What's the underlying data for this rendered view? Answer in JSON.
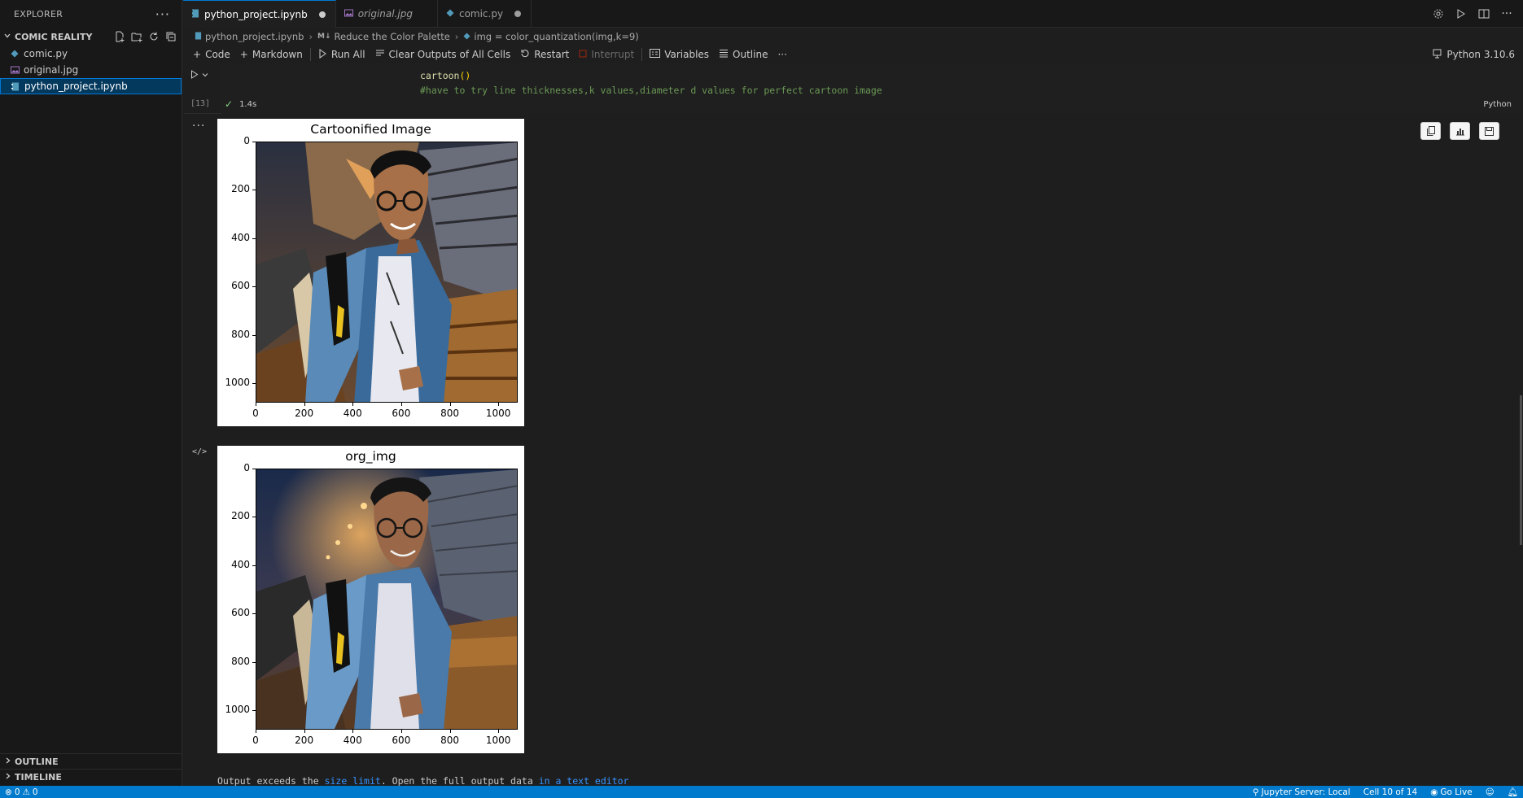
{
  "sidebar": {
    "title": "EXPLORER",
    "more": "···",
    "folder": "COMIC REALITY",
    "files": [
      {
        "name": "comic.py",
        "icon": "python-file-icon",
        "color": "#519aba"
      },
      {
        "name": "original.jpg",
        "icon": "image-file-icon",
        "color": "#a074c4"
      },
      {
        "name": "python_project.ipynb",
        "icon": "notebook-file-icon",
        "color": "#519aba"
      }
    ],
    "outline": "OUTLINE",
    "timeline": "TIMELINE"
  },
  "tabs": [
    {
      "label": "python_project.ipynb",
      "active": true,
      "dirty": true
    },
    {
      "label": "original.jpg",
      "active": false,
      "italic": true
    },
    {
      "label": "comic.py",
      "active": false,
      "dirty": true
    }
  ],
  "breadcrumb": {
    "file": "python_project.ipynb",
    "md_tag": "M↓",
    "section": "Reduce the Color Palette",
    "symbol": "img = color_quantization(img,k=9)"
  },
  "toolbar": {
    "code": "Code",
    "markdown": "Markdown",
    "run_all": "Run All",
    "clear": "Clear Outputs of All Cells",
    "restart": "Restart",
    "interrupt": "Interrupt",
    "variables": "Variables",
    "outline": "Outline",
    "more": "···",
    "kernel": "Python 3.10.6"
  },
  "cell": {
    "line1_fn": "cartoon",
    "line1_paren": "()",
    "line2_comment": "#have to try line thicknesses,k values,diameter d values for perfect cartoon image",
    "exec_count": "[13]",
    "duration": "1.4s",
    "language": "Python"
  },
  "figures": [
    {
      "title": "Cartoonified Image",
      "y_ticks": [
        "0",
        "200",
        "400",
        "600",
        "800",
        "1000"
      ],
      "x_ticks": [
        "0",
        "200",
        "400",
        "600",
        "800",
        "1000"
      ]
    },
    {
      "title": "org_img",
      "y_ticks": [
        "0",
        "200",
        "400",
        "600",
        "800",
        "1000"
      ],
      "x_ticks": [
        "0",
        "200",
        "400",
        "600",
        "800",
        "1000"
      ]
    }
  ],
  "output": {
    "more": "···",
    "code_icon": "</>",
    "limit_pre": "Output exceeds the ",
    "limit_link1": "size limit",
    "limit_mid": ". Open the full output data ",
    "limit_link2": "in a text editor"
  },
  "statusbar": {
    "problems_errors": "0",
    "problems_warnings": "0",
    "jupyter": "Jupyter Server: Local",
    "cell_pos": "Cell 10 of 14",
    "go_live": "Go Live"
  }
}
